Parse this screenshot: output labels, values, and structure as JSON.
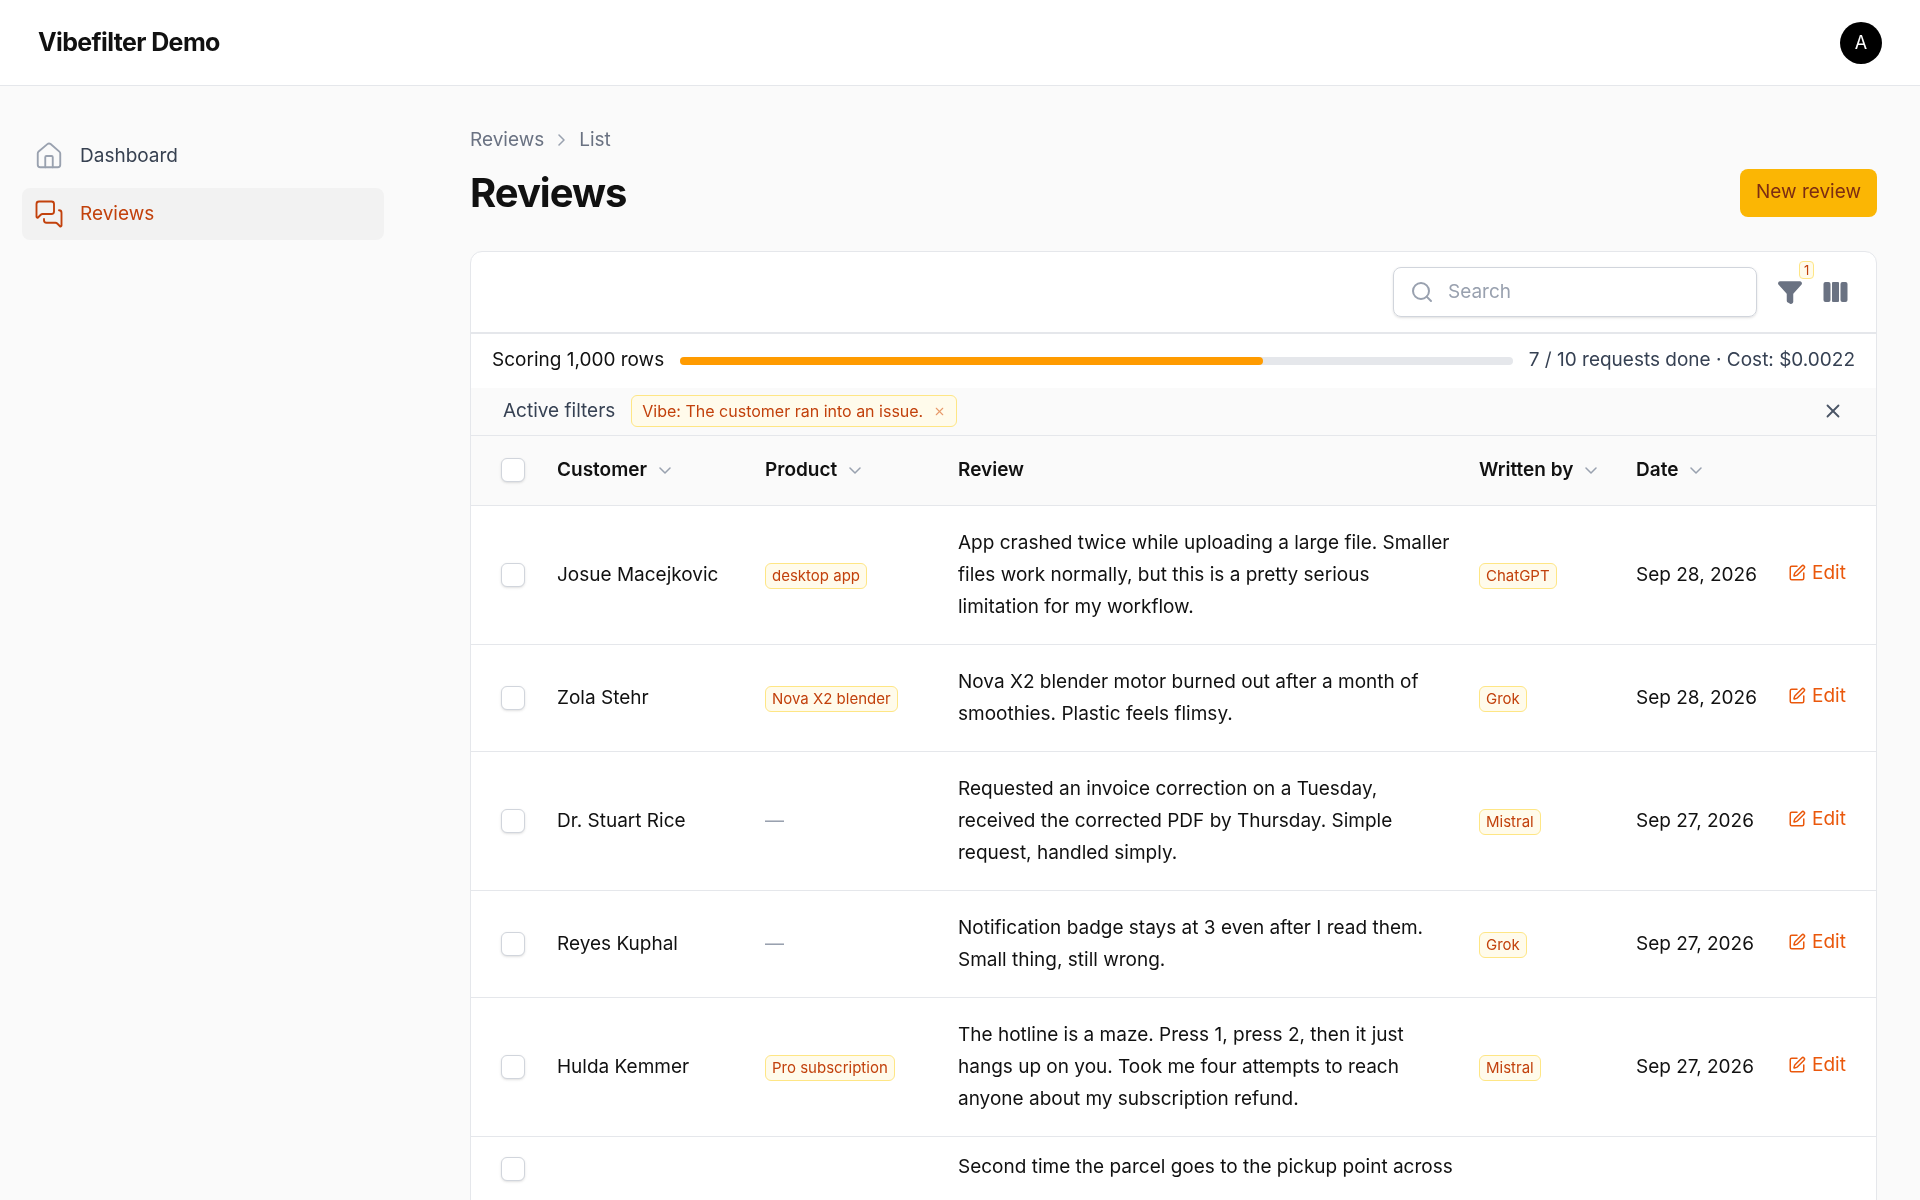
{
  "app": {
    "title": "Vibefilter Demo",
    "avatar": "A"
  },
  "sidebar": {
    "items": [
      {
        "label": "Dashboard",
        "selected": false
      },
      {
        "label": "Reviews",
        "selected": true
      }
    ]
  },
  "breadcrumb": [
    "Reviews",
    "List"
  ],
  "page_title": "Reviews",
  "primary_button": "New review",
  "toolbar": {
    "search": {
      "placeholder": "Search"
    },
    "filter_count": "1"
  },
  "progress": {
    "label": "Scoring 1,000 rows",
    "level": 0.7,
    "status": "7 / 10 requests done · Cost: $0.0022"
  },
  "active_filters": {
    "label": "Active filters",
    "chips": [
      "Vibe: The customer ran into an issue."
    ]
  },
  "table": {
    "all_checked": false,
    "columns": [
      {
        "label": "Customer",
        "sortable": true
      },
      {
        "label": "Product",
        "sortable": true
      },
      {
        "label": "Review",
        "sortable": false
      },
      {
        "label": "Written by",
        "sortable": true
      },
      {
        "label": "Date",
        "sortable": true
      }
    ],
    "rows": [
      {
        "checked": false,
        "customer": "Josue Macejkovic",
        "product": "desktop app",
        "review": "App crashed twice while uploading a large file. Smaller files work normally, but this is a pretty serious limitation for my workflow.",
        "written_by": "ChatGPT",
        "date": "Sep 28, 2026",
        "action": "Edit"
      },
      {
        "checked": false,
        "customer": "Zola Stehr",
        "product": "Nova X2 blender",
        "review": "Nova X2 blender motor burned out after a month of smoothies. Plastic feels flimsy.",
        "written_by": "Grok",
        "date": "Sep 28, 2026",
        "action": "Edit"
      },
      {
        "checked": false,
        "customer": "Dr. Stuart Rice",
        "product": "—",
        "review": "Requested an invoice correction on a Tuesday, received the corrected PDF by Thursday. Simple request, handled simply.",
        "written_by": "Mistral",
        "date": "Sep 27, 2026",
        "action": "Edit"
      },
      {
        "checked": false,
        "customer": "Reyes Kuphal",
        "product": "—",
        "review": "Notification badge stays at 3 even after I read them. Small thing, still wrong.",
        "written_by": "Grok",
        "date": "Sep 27, 2026",
        "action": "Edit"
      },
      {
        "checked": false,
        "customer": "Hulda Kemmer",
        "product": "Pro subscription",
        "review": "The hotline is a maze. Press 1, press 2, then it just hangs up on you. Took me four attempts to reach anyone about my subscription refund.",
        "written_by": "Mistral",
        "date": "Sep 27, 2026",
        "action": "Edit"
      },
      {
        "checked": false,
        "review": "Second time the parcel goes to the pickup point across"
      }
    ]
  }
}
